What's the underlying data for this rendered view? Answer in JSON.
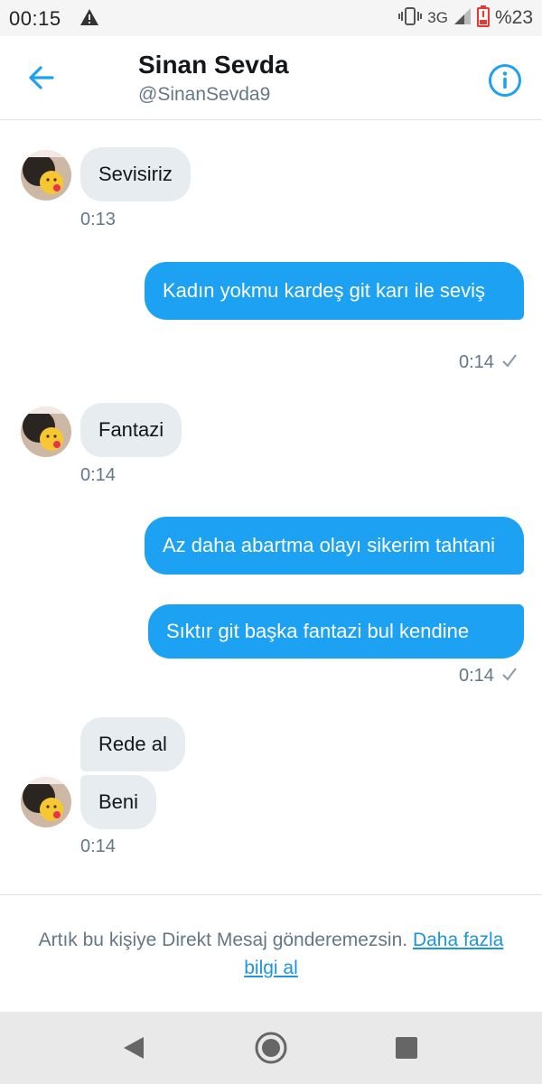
{
  "status_bar": {
    "time": "00:15",
    "network": "3G",
    "battery": "%23",
    "icons": [
      "warning-icon",
      "vibrate-icon",
      "signal-icon",
      "battery-icon"
    ]
  },
  "header": {
    "name": "Sinan Sevda",
    "handle": "@SinanSevda9",
    "icons": [
      "back-arrow-icon",
      "info-icon"
    ]
  },
  "colors": {
    "accent": "#1da1f2",
    "incoming_bubble": "#e6ecf0",
    "secondary_text": "#657786",
    "link": "#1b95e0"
  },
  "messages": [
    {
      "text": "Sevisiriz",
      "time": "0:13"
    },
    {
      "text": "Kadın yokmu kardeş git karı ile seviş",
      "time": "0:14"
    },
    {
      "text": "Fantazi",
      "time": "0:14"
    },
    {
      "text": "Az daha abartma olayı sikerim tahtani"
    },
    {
      "text": "Sıktır git başka fantazi bul kendine",
      "time": "0:14"
    },
    {
      "text": "Rede al"
    },
    {
      "text": "Beni",
      "time": "0:14"
    }
  ],
  "notice": {
    "text": "Artık bu kişiye Direkt Mesaj gönderemezsin. ",
    "link": "Daha fazla bilgi al"
  },
  "nav": {
    "icons": [
      "back-triangle-icon",
      "home-circle-icon",
      "recents-square-icon"
    ]
  }
}
